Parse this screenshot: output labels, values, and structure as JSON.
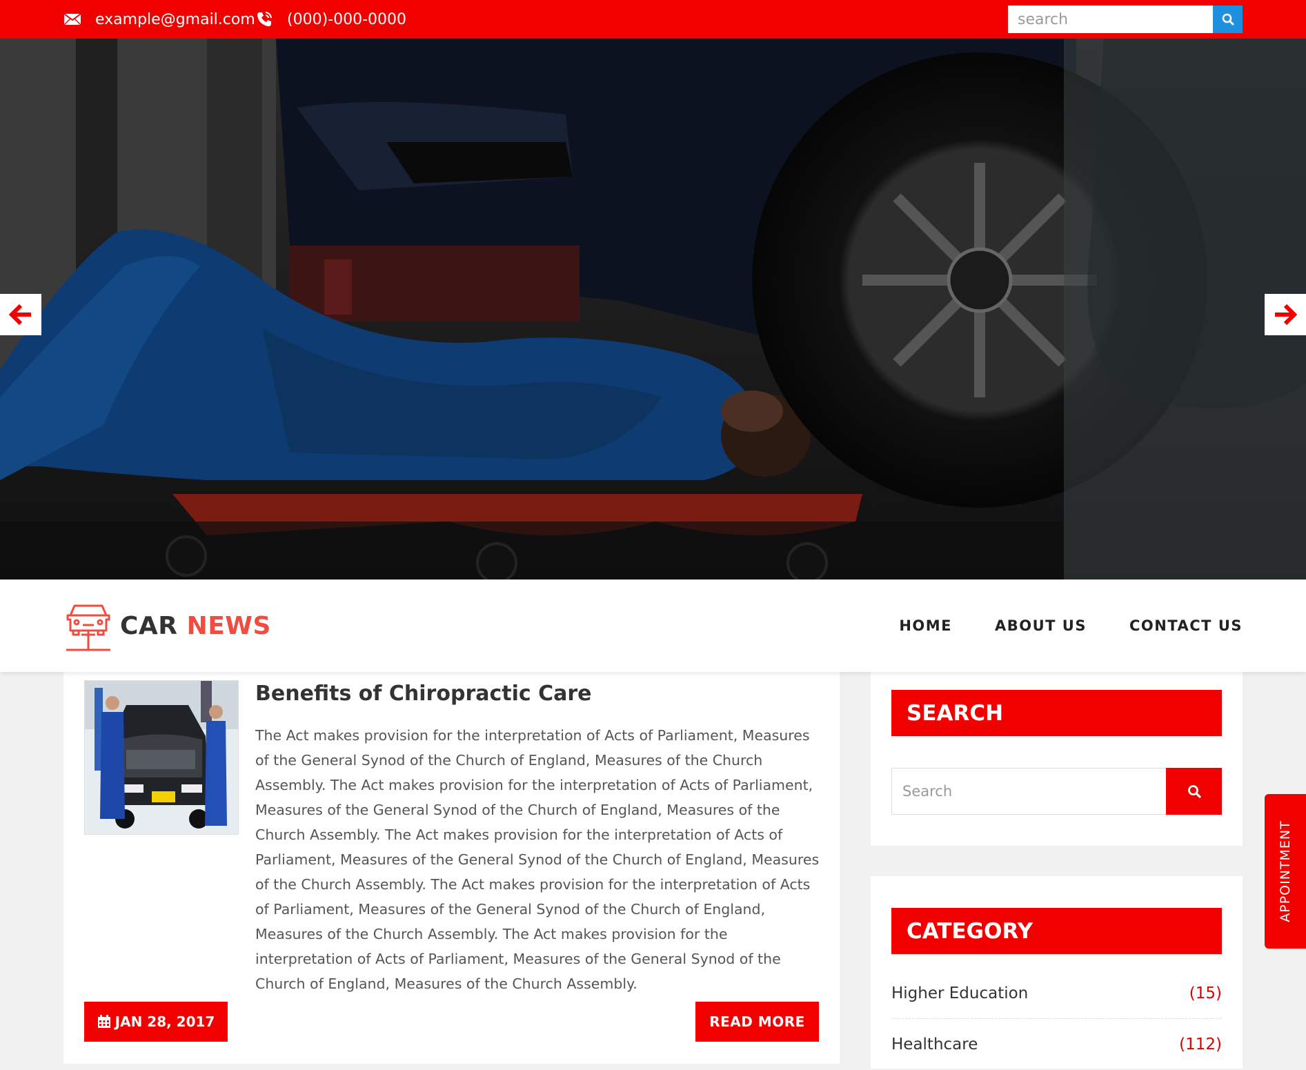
{
  "topbar": {
    "email": "example@gmail.com",
    "phone": "(000)-000-0000",
    "search_placeholder": "search",
    "icons": [
      "envelope-icon",
      "phone-icon",
      "search-icon"
    ]
  },
  "hero": {
    "prev_icon": "arrow-left-icon",
    "next_icon": "arrow-right-icon"
  },
  "header": {
    "logo_word1": "CAR",
    "logo_word2": "NEWS",
    "nav": [
      "HOME",
      "ABOUT US",
      "CONTACT US"
    ]
  },
  "post": {
    "title": "Benefits of Chiropractic Care",
    "body": "The Act makes provision for the interpretation of Acts of Parliament, Measures of the General Synod of the Church of England, Measures of the Church Assembly. The Act makes provision for the interpretation of Acts of Parliament, Measures of the General Synod of the Church of England, Measures of the Church Assembly. The Act makes provision for the interpretation of Acts of Parliament, Measures of the General Synod of the Church of England, Measures of the Church Assembly. The Act makes provision for the interpretation of Acts of Parliament, Measures of the General Synod of the Church of England, Measures of the Church Assembly. The Act makes provision for the interpretation of Acts of Parliament, Measures of the General Synod of the Church of England, Measures of the Church Assembly.",
    "date": "JAN 28, 2017",
    "read_more": "READ MORE"
  },
  "sidebar": {
    "search_title": "SEARCH",
    "search_placeholder": "Search",
    "category_title": "CATEGORY",
    "categories": [
      {
        "name": "Higher Education",
        "count": "(15)"
      },
      {
        "name": "Healthcare",
        "count": "(112)"
      }
    ]
  },
  "appointment": "APPOINTMENT",
  "colors": {
    "primary_red": "#f20000",
    "logo_red": "#f24b40",
    "search_blue": "#1e90e0"
  }
}
